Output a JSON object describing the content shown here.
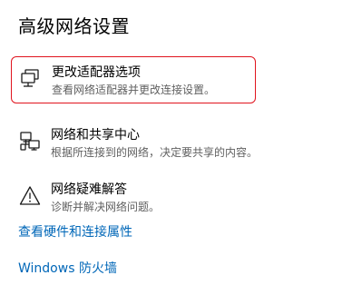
{
  "section_title": "高级网络设置",
  "items": [
    {
      "title": "更改适配器选项",
      "description": "查看网络适配器并更改连接设置。",
      "icon": "network-adapter-icon",
      "highlighted": true
    },
    {
      "title": "网络和共享中心",
      "description": "根据所连接到的网络，决定要共享的内容。",
      "icon": "sharing-center-icon",
      "highlighted": false
    },
    {
      "title": "网络疑难解答",
      "description": "诊断并解决网络问题。",
      "icon": "warning-icon",
      "highlighted": false
    }
  ],
  "links": [
    {
      "label": "查看硬件和连接属性"
    },
    {
      "label": "Windows 防火墙"
    }
  ],
  "colors": {
    "highlight_border": "#e0141e",
    "link": "#0067b8",
    "description_text": "#5f5f5f"
  }
}
